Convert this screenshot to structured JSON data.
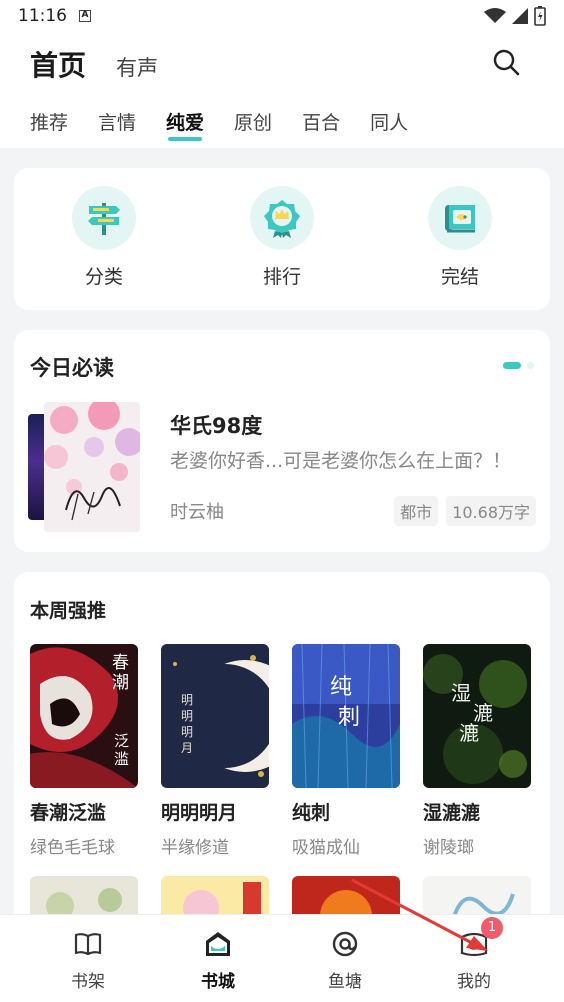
{
  "status": {
    "time": "11:16"
  },
  "header": {
    "main_tabs": [
      {
        "label": "首页"
      },
      {
        "label": "有声"
      }
    ],
    "sub_tabs": [
      {
        "label": "推荐"
      },
      {
        "label": "言情"
      },
      {
        "label": "纯爱"
      },
      {
        "label": "原创"
      },
      {
        "label": "百合"
      },
      {
        "label": "同人"
      }
    ],
    "active_sub_tab": "纯爱"
  },
  "quick_entries": [
    {
      "label": "分类",
      "icon": "signpost-icon"
    },
    {
      "label": "排行",
      "icon": "medal-icon"
    },
    {
      "label": "完结",
      "icon": "scroll-icon"
    }
  ],
  "daily": {
    "title": "今日必读",
    "book": {
      "title": "华氏98度",
      "description": "老婆你好香...可是老婆你怎么在上面？！",
      "author": "时云柚",
      "tags": [
        "都市",
        "10.68万字"
      ]
    }
  },
  "weekly": {
    "title": "本周强推",
    "books": [
      {
        "title": "春潮泛滥",
        "author": "绿色毛毛球",
        "cover_text": "春潮 泛滥"
      },
      {
        "title": "明明明月",
        "author": "半缘修道",
        "cover_text": "明明明月"
      },
      {
        "title": "纯刺",
        "author": "吸猫成仙",
        "cover_text": "纯刺"
      },
      {
        "title": "湿漉漉",
        "author": "谢陵瑯",
        "cover_text": "湿漉漉"
      }
    ]
  },
  "bottom_nav": {
    "items": [
      {
        "label": "书架",
        "icon": "book-open-icon"
      },
      {
        "label": "书城",
        "icon": "store-icon"
      },
      {
        "label": "鱼塘",
        "icon": "at-icon"
      },
      {
        "label": "我的",
        "icon": "profile-icon"
      }
    ],
    "active": "书城",
    "badge": "1"
  },
  "colors": {
    "accent": "#3cc7c0",
    "badge": "#f25b6a",
    "annotation_arrow": "#e53935"
  }
}
